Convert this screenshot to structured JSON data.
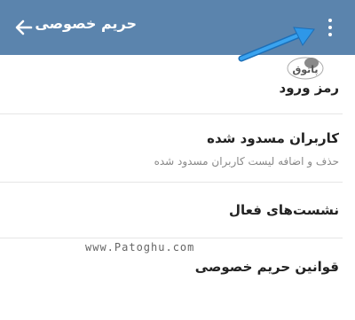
{
  "header": {
    "title": "حریم خصوصی",
    "back_icon": "arrow-back-icon",
    "menu_icon": "more-vertical-icon",
    "background": "#5b84ad"
  },
  "annotation": {
    "arrow_color": "#2e97e8",
    "logo_text": "پاتوق"
  },
  "items": [
    {
      "label": "رمز ورود"
    },
    {
      "label": "کاربران مسدود شده",
      "sub": "حذف و اضافه لیست کاربران مسدود شده"
    },
    {
      "label": "نشست‌های فعال"
    },
    {
      "label": "قوانین حریم خصوصی"
    }
  ],
  "watermark": "www.Patoghu.com"
}
